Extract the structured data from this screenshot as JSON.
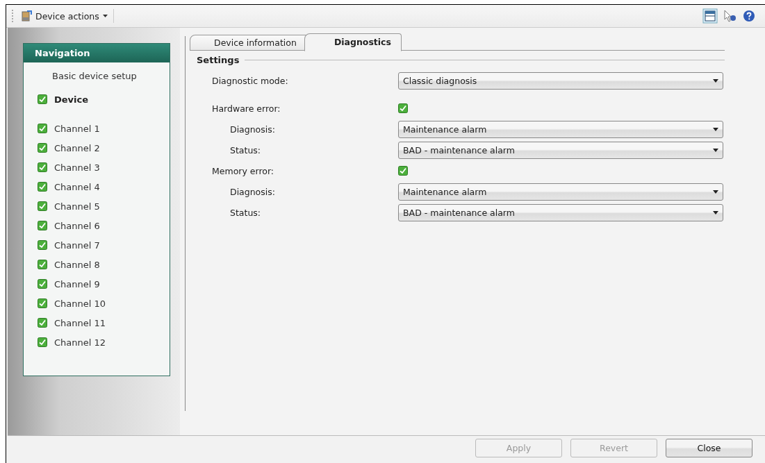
{
  "toolbar": {
    "menu": "Device actions"
  },
  "navigation": {
    "title": "Navigation",
    "items": [
      {
        "label": "Basic device setup",
        "kind": "plain",
        "selected": false
      },
      {
        "label": "Device",
        "kind": "check",
        "checked": true,
        "selected": true
      },
      {
        "label": "Channel 1",
        "kind": "check",
        "checked": true,
        "selected": false
      },
      {
        "label": "Channel 2",
        "kind": "check",
        "checked": true,
        "selected": false
      },
      {
        "label": "Channel 3",
        "kind": "check",
        "checked": true,
        "selected": false
      },
      {
        "label": "Channel 4",
        "kind": "check",
        "checked": true,
        "selected": false
      },
      {
        "label": "Channel 5",
        "kind": "check",
        "checked": true,
        "selected": false
      },
      {
        "label": "Channel 6",
        "kind": "check",
        "checked": true,
        "selected": false
      },
      {
        "label": "Channel 7",
        "kind": "check",
        "checked": true,
        "selected": false
      },
      {
        "label": "Channel 8",
        "kind": "check",
        "checked": true,
        "selected": false
      },
      {
        "label": "Channel 9",
        "kind": "check",
        "checked": true,
        "selected": false
      },
      {
        "label": "Channel 10",
        "kind": "check",
        "checked": true,
        "selected": false
      },
      {
        "label": "Channel 11",
        "kind": "check",
        "checked": true,
        "selected": false
      },
      {
        "label": "Channel 12",
        "kind": "check",
        "checked": true,
        "selected": false
      }
    ]
  },
  "tabs": [
    {
      "label": "Device information",
      "selected": false
    },
    {
      "label": "Diagnostics",
      "selected": true
    }
  ],
  "settings": {
    "title": "Settings",
    "fields": [
      {
        "label": "Diagnostic mode:",
        "kind": "dropdown",
        "value": "Classic diagnosis"
      },
      {
        "label": "Hardware error:",
        "kind": "checkbox",
        "checked": true,
        "children": [
          {
            "label": "Diagnosis:",
            "kind": "dropdown",
            "value": "Maintenance alarm"
          },
          {
            "label": "Status:",
            "kind": "dropdown",
            "value": "BAD - maintenance alarm"
          }
        ]
      },
      {
        "label": "Memory error:",
        "kind": "checkbox",
        "checked": true,
        "children": [
          {
            "label": "Diagnosis:",
            "kind": "dropdown",
            "value": "Maintenance alarm"
          },
          {
            "label": "Status:",
            "kind": "dropdown",
            "value": "BAD - maintenance alarm"
          }
        ]
      }
    ]
  },
  "buttons": [
    {
      "label": "Apply",
      "disabled": true
    },
    {
      "label": "Revert",
      "disabled": true
    },
    {
      "label": "Close",
      "disabled": false
    }
  ]
}
